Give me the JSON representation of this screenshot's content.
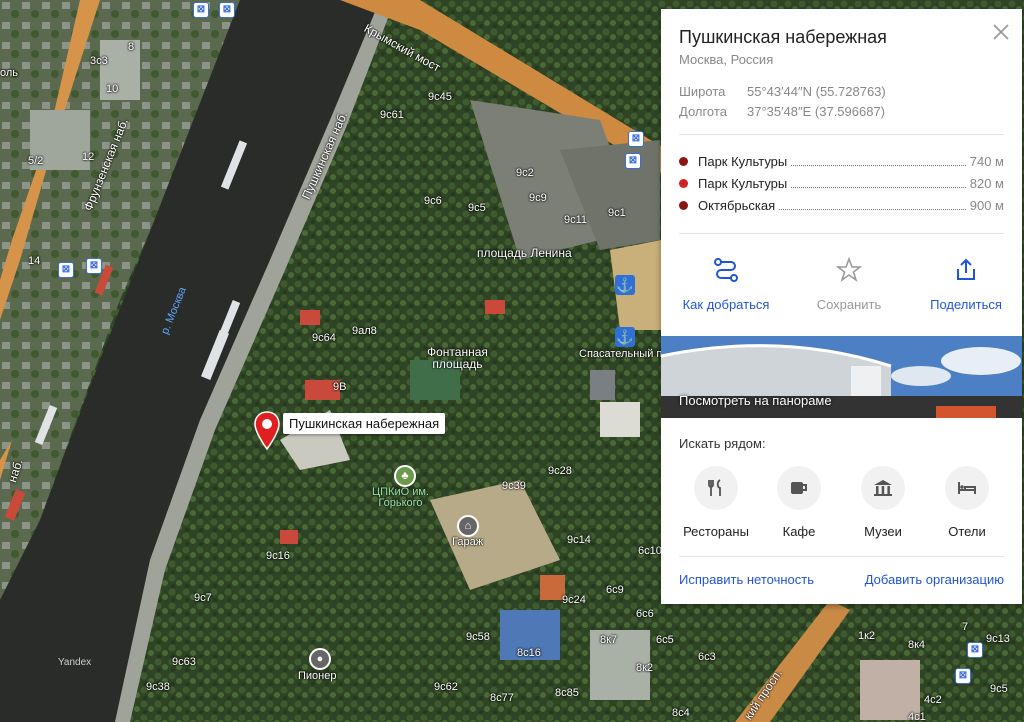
{
  "card": {
    "title": "Пушкинская набережная",
    "subtitle": "Москва, Россия",
    "lat_label": "Широта",
    "lat_value": "55°43′44″N (55.728763)",
    "lon_label": "Долгота",
    "lon_value": "37°35′48″E (37.596687)",
    "stations": [
      {
        "name": "Парк Культуры",
        "distance": "740 м",
        "color": "#8b1414"
      },
      {
        "name": "Парк Культуры",
        "distance": "820 м",
        "color": "#d42020"
      },
      {
        "name": "Октябрьская",
        "distance": "900 м",
        "color": "#8b1414"
      }
    ],
    "actions": {
      "route": "Как добраться",
      "save": "Сохранить",
      "share": "Поделиться"
    },
    "panorama_text": "Посмотреть на панораме",
    "nearby_title": "Искать рядом:",
    "categories": {
      "restaurants": "Рестораны",
      "cafe": "Кафе",
      "museums": "Музеи",
      "hotels": "Отели"
    },
    "fix_link": "Исправить неточность",
    "add_org_link": "Добавить организацию"
  },
  "map": {
    "pin_label": "Пушкинская набережная",
    "streets": {
      "krymsky": "Крымский мост",
      "frunzenskaya": "Фрунзенская наб.",
      "pushkinskaya": "Пушкинская наб.",
      "nab_left": "наб.",
      "prosp": "кий просп.",
      "pl_part": "оль"
    },
    "river": "р. Москва",
    "squares": {
      "lenina": "площадь Ленина",
      "fontannaya": "Фонтанная\nплощадь"
    },
    "park": "ЦПКиО им.\nГорького",
    "garage": "Гараж",
    "pioneer": "Пионер",
    "rescue": "Спасательный п",
    "yandex": "Yandex",
    "building_labels": {
      "b1": "8",
      "b2": "3с3",
      "b3": "10",
      "b4": "12",
      "b5": "5/2",
      "b6": "14",
      "b7": "9с45",
      "b8": "9с61",
      "b9": "9с2",
      "b10": "9с6",
      "b11": "9с5",
      "b12": "9с9",
      "b13": "9с11",
      "b14": "9с1",
      "b15": "9с64",
      "b16": "9ал8",
      "b17": "9В",
      "b18": "9с28",
      "b19": "9с39",
      "b20": "9с14",
      "b21": "6с10",
      "b22": "6с9",
      "b23": "6с6",
      "b24": "6с5",
      "b25": "6с3",
      "b26": "8к7",
      "b27": "8к2",
      "b28": "9с24",
      "b29": "9с58",
      "b30": "8с16",
      "b31": "8с77",
      "b32": "8с85",
      "b33": "9с62",
      "b34": "9с16",
      "b35": "9с7",
      "b36": "9с63",
      "b37": "9с38",
      "b38": "8с4",
      "b39": "1к2",
      "b40": "4с1",
      "b41": "4с2",
      "b42": "9с13",
      "b43": "9с5",
      "b44": "8к4",
      "b45": "7"
    }
  }
}
